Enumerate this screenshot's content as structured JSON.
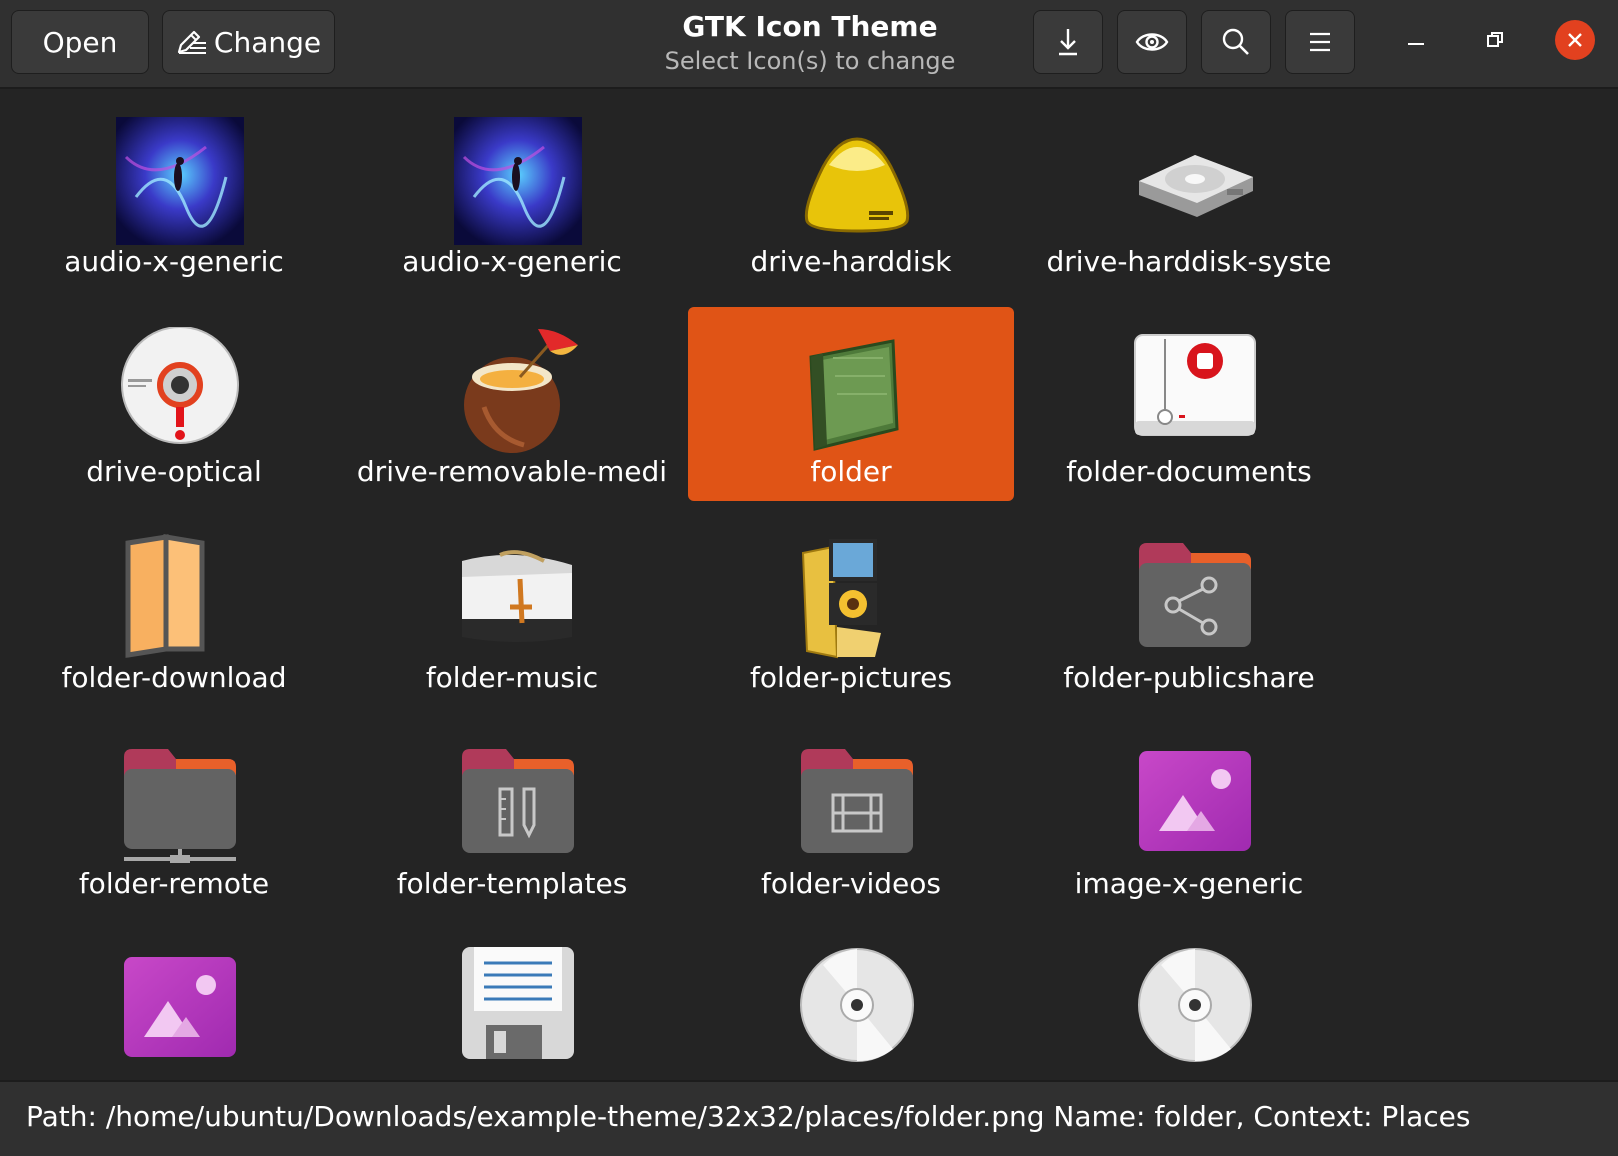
{
  "header": {
    "open_label": "Open",
    "change_label": "Change",
    "title": "GTK Icon Theme",
    "subtitle": "Select Icon(s) to change"
  },
  "icons": [
    {
      "label": "audio-x-generic",
      "icon": "space-artwork-icon"
    },
    {
      "label": "audio-x-generic",
      "icon": "space-artwork-icon"
    },
    {
      "label": "drive-harddisk",
      "icon": "yellow-harddisk-icon"
    },
    {
      "label": "drive-harddisk-syste",
      "icon": "silver-harddisk-icon"
    },
    {
      "label": "drive-optical",
      "icon": "optical-disc-icon"
    },
    {
      "label": "drive-removable-medi",
      "icon": "coconut-drink-icon"
    },
    {
      "label": "folder",
      "icon": "green-folder-icon",
      "selected": true
    },
    {
      "label": "folder-documents",
      "icon": "documents-box-icon"
    },
    {
      "label": "folder-download",
      "icon": "orange-folder-icon"
    },
    {
      "label": "folder-music",
      "icon": "music-folder-icon"
    },
    {
      "label": "folder-pictures",
      "icon": "pictures-folder-icon"
    },
    {
      "label": "folder-publicshare",
      "icon": "share-folder-icon"
    },
    {
      "label": "folder-remote",
      "icon": "remote-folder-icon"
    },
    {
      "label": "folder-templates",
      "icon": "templates-folder-icon"
    },
    {
      "label": "folder-videos",
      "icon": "videos-folder-icon"
    },
    {
      "label": "image-x-generic",
      "icon": "image-icon"
    },
    {
      "label": "",
      "icon": "image-icon"
    },
    {
      "label": "",
      "icon": "floppy-icon"
    },
    {
      "label": "",
      "icon": "cd-icon"
    },
    {
      "label": "",
      "icon": "cd-icon"
    }
  ],
  "status": {
    "text": "Path: /home/ubuntu/Downloads/example-theme/32x32/places/folder.png Name: folder, Context: Places"
  },
  "colors": {
    "selected": "#e05416",
    "close": "#e2411f",
    "background": "#242424",
    "header": "#303030"
  }
}
